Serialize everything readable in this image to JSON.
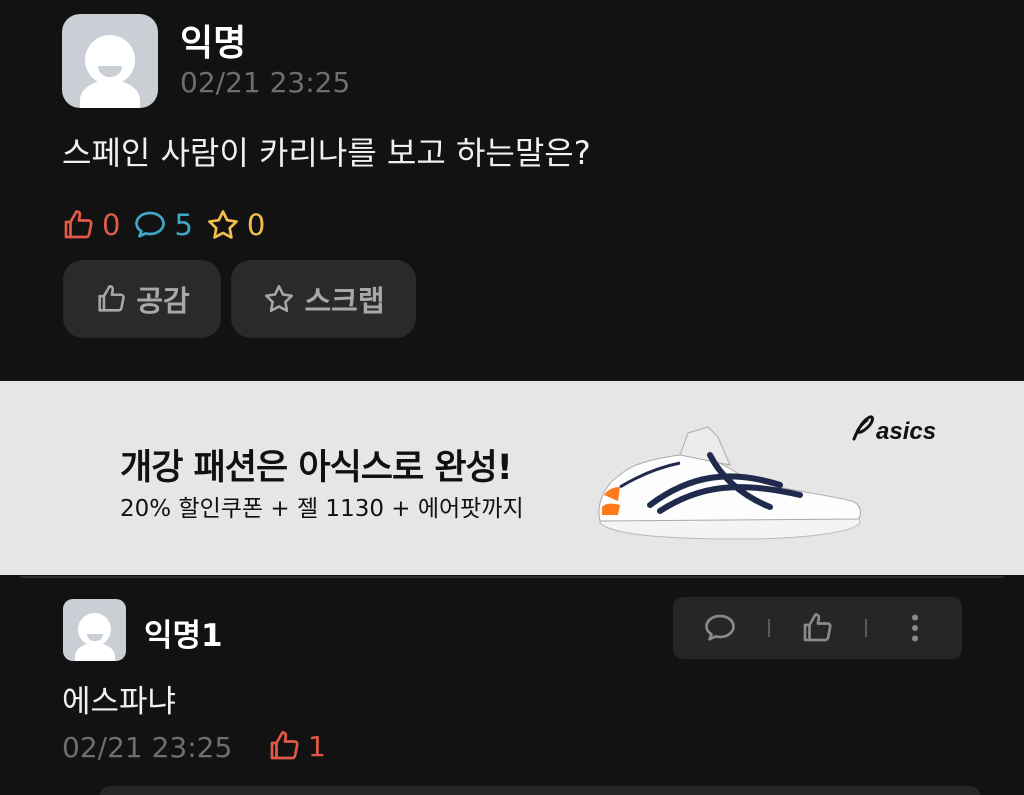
{
  "post": {
    "author": "익명",
    "timestamp": "02/21 23:25",
    "body": "스페인 사람이 카리나를 보고 하는말은?",
    "stats": {
      "likes": "0",
      "comments": "5",
      "scraps": "0"
    },
    "like_button_label": "공감",
    "scrap_button_label": "스크랩",
    "icons": {
      "like": "thumbs-up-icon",
      "comment": "speech-bubble-icon",
      "scrap": "star-icon"
    }
  },
  "ad": {
    "headline": "개강 패션은 아식스로 완성!",
    "subline": "20% 할인쿠폰 + 젤 1130 + 에어팟까지",
    "brand": "asics"
  },
  "comment": {
    "author": "익명1",
    "body": "에스파냐",
    "timestamp": "02/21 23:25",
    "likes": "1"
  },
  "colors": {
    "like": "#e05a47",
    "comment": "#3fa7c8",
    "scrap": "#f2c04a",
    "background": "#121212"
  }
}
